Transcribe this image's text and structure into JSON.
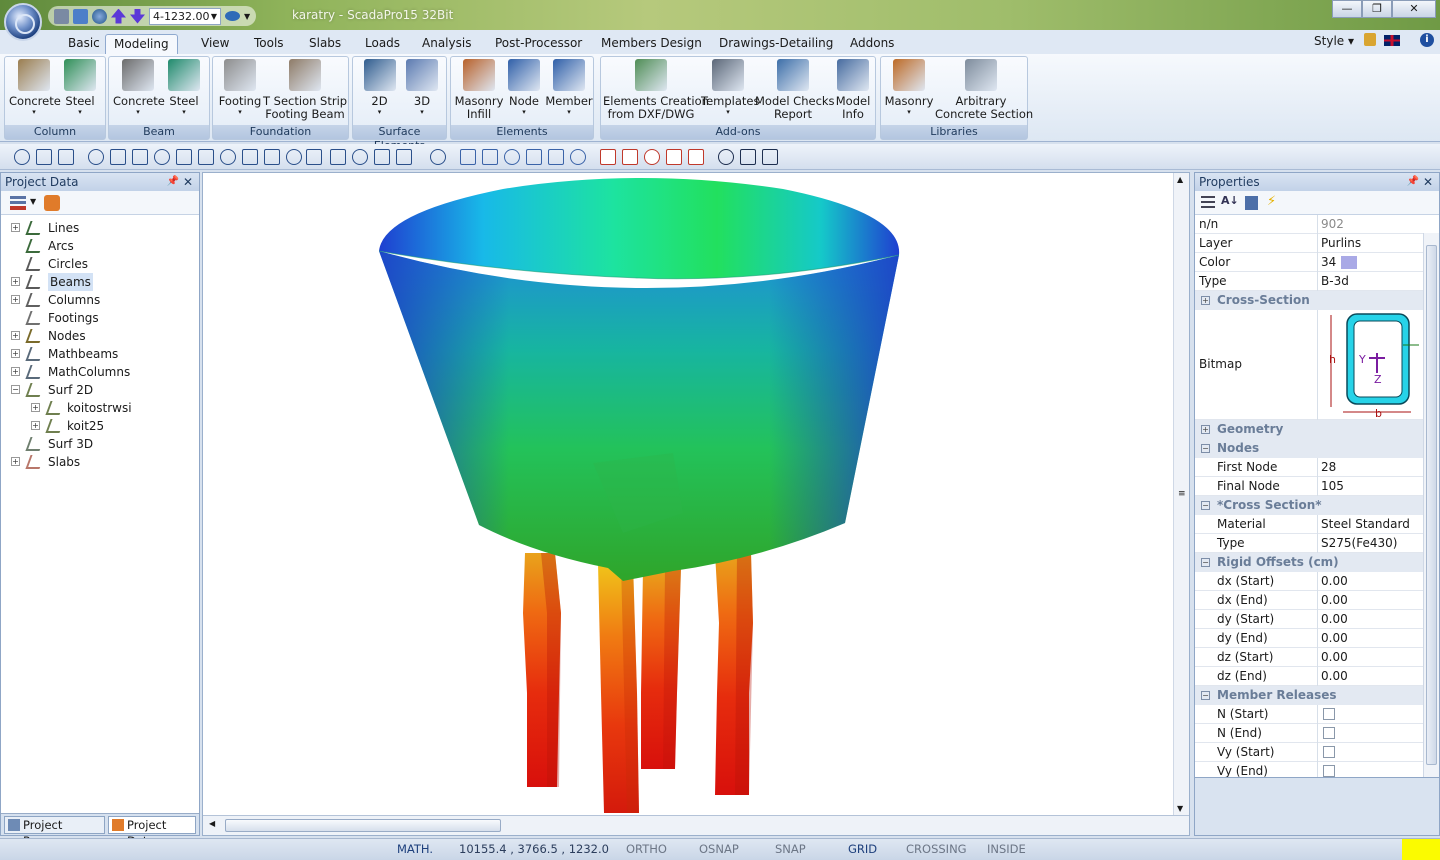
{
  "window": {
    "title": "karatry - ScadaPro15 32Bit",
    "combo_value": "4-1232.00",
    "controls": {
      "minimize": "—",
      "restore": "❐",
      "close": "✕"
    }
  },
  "tabs": [
    "Basic",
    "Modeling",
    "View",
    "Tools",
    "Slabs",
    "Loads",
    "Analysis",
    "Post-Processor",
    "Members Design",
    "Drawings-Detailing",
    "Addons"
  ],
  "active_tab": "Modeling",
  "right_menu": {
    "style_label": "Style"
  },
  "ribbon": {
    "groups": [
      {
        "label": "Column",
        "buttons": [
          {
            "label": "Concrete",
            "icon": "concrete-column-icon"
          },
          {
            "label": "Steel",
            "icon": "steel-column-icon"
          }
        ]
      },
      {
        "label": "Beam",
        "buttons": [
          {
            "label": "Concrete",
            "icon": "concrete-beam-icon"
          },
          {
            "label": "Steel",
            "icon": "steel-beam-icon"
          }
        ]
      },
      {
        "label": "Foundation",
        "buttons": [
          {
            "label": "Footing",
            "icon": "footing-icon"
          },
          {
            "label": "T Section Strip",
            "label2": "Footing Beam",
            "icon": "strip-footing-icon"
          }
        ]
      },
      {
        "label": "Surface Elements",
        "buttons": [
          {
            "label": "2D",
            "icon": "surface-2d-icon"
          },
          {
            "label": "3D",
            "icon": "surface-3d-icon"
          }
        ]
      },
      {
        "label": "Elements",
        "buttons": [
          {
            "label": "Masonry",
            "label2": "Infill",
            "icon": "masonry-infill-icon"
          },
          {
            "label": "Node",
            "icon": "node-icon"
          },
          {
            "label": "Member",
            "icon": "member-icon"
          }
        ]
      },
      {
        "label": "Add-ons",
        "buttons": [
          {
            "label": "Elements Creation",
            "label2": "from DXF/DWG",
            "icon": "dxf-import-icon"
          },
          {
            "label": "Templates",
            "icon": "templates-icon"
          },
          {
            "label": "Model Checks",
            "label2": "Report",
            "icon": "model-checks-icon"
          },
          {
            "label": "Model",
            "label2": "Info",
            "icon": "model-info-icon"
          }
        ]
      },
      {
        "label": "Libraries",
        "buttons": [
          {
            "label": "Masonry",
            "icon": "masonry-library-icon"
          },
          {
            "label": "Arbitrary",
            "label2": "Concrete Section",
            "icon": "arbitrary-section-icon"
          }
        ]
      }
    ]
  },
  "project_panel": {
    "title": "Project Data",
    "tree": [
      {
        "label": "Lines",
        "icon": "line-icon",
        "expandable": true
      },
      {
        "label": "Arcs",
        "icon": "arc-icon",
        "expandable": false
      },
      {
        "label": "Circles",
        "icon": "circle-icon",
        "expandable": false
      },
      {
        "label": "Beams",
        "icon": "beam-icon",
        "expandable": true,
        "selected": true
      },
      {
        "label": "Columns",
        "icon": "column-icon",
        "expandable": true
      },
      {
        "label": "Footings",
        "icon": "footing-icon",
        "expandable": false
      },
      {
        "label": "Nodes",
        "icon": "node-icon",
        "expandable": true
      },
      {
        "label": "Mathbeams",
        "icon": "mathbeam-icon",
        "expandable": true
      },
      {
        "label": "MathColumns",
        "icon": "mathcolumn-icon",
        "expandable": true
      },
      {
        "label": "Surf 2D",
        "icon": "surface-2d-icon",
        "expandable": true,
        "expanded": true
      },
      {
        "label": "koitostrwsi",
        "icon": "surface-2d-icon",
        "expandable": true,
        "child": true
      },
      {
        "label": "koit25",
        "icon": "surface-2d-icon",
        "expandable": true,
        "child": true
      },
      {
        "label": "Surf 3D",
        "icon": "surface-3d-icon",
        "expandable": false
      },
      {
        "label": "Slabs",
        "icon": "slab-icon",
        "expandable": true
      }
    ],
    "bottom_tabs": [
      "Project Param...",
      "Project Data"
    ]
  },
  "properties": {
    "title": "Properties",
    "rows": [
      {
        "kind": "prop",
        "key": "n/n",
        "value": "902",
        "muted": true
      },
      {
        "kind": "prop",
        "key": "Layer",
        "value": "Purlins"
      },
      {
        "kind": "prop",
        "key": "Color",
        "value": "34",
        "swatch": "#a9a9e6"
      },
      {
        "kind": "prop",
        "key": "Type",
        "value": "B-3d"
      },
      {
        "kind": "cat",
        "key": "Cross-Section",
        "collapsed": true
      },
      {
        "kind": "bitmap",
        "key": "Bitmap"
      },
      {
        "kind": "cat",
        "key": "Geometry",
        "collapsed": true
      },
      {
        "kind": "cat",
        "key": "Nodes",
        "collapsed": false
      },
      {
        "kind": "prop",
        "key": "First Node",
        "value": "28",
        "sub": true
      },
      {
        "kind": "prop",
        "key": "Final Node",
        "value": "105",
        "sub": true
      },
      {
        "kind": "cat",
        "key": "*Cross Section*",
        "collapsed": false
      },
      {
        "kind": "prop",
        "key": "Material",
        "value": "Steel Standard",
        "sub": true
      },
      {
        "kind": "prop",
        "key": "Type",
        "value": "S275(Fe430)",
        "sub": true
      },
      {
        "kind": "cat",
        "key": "Rigid Offsets (cm)",
        "collapsed": false
      },
      {
        "kind": "prop",
        "key": "dx (Start)",
        "value": "0.00",
        "sub": true
      },
      {
        "kind": "prop",
        "key": "dx (End)",
        "value": "0.00",
        "sub": true
      },
      {
        "kind": "prop",
        "key": "dy (Start)",
        "value": "0.00",
        "sub": true
      },
      {
        "kind": "prop",
        "key": "dy (End)",
        "value": "0.00",
        "sub": true
      },
      {
        "kind": "prop",
        "key": "dz (Start)",
        "value": "0.00",
        "sub": true
      },
      {
        "kind": "prop",
        "key": "dz (End)",
        "value": "0.00",
        "sub": true
      },
      {
        "kind": "cat",
        "key": "Member Releases",
        "collapsed": false
      },
      {
        "kind": "check",
        "key": "N (Start)",
        "sub": true
      },
      {
        "kind": "check",
        "key": "N (End)",
        "sub": true
      },
      {
        "kind": "check",
        "key": "Vy (Start)",
        "sub": true
      },
      {
        "kind": "check",
        "key": "Vy (End)",
        "sub": true
      }
    ],
    "section_labels": {
      "h": "h",
      "b": "b",
      "y": "Y",
      "z": "Z"
    }
  },
  "status": {
    "math": "MATH.",
    "coords": "10155.4 , 3766.5 , 1232.0",
    "toggles": [
      {
        "label": "ORTHO",
        "on": false
      },
      {
        "label": "OSNAP",
        "on": false
      },
      {
        "label": "SNAP",
        "on": false
      },
      {
        "label": "GRID",
        "on": true
      },
      {
        "label": "CROSSING",
        "on": false
      },
      {
        "label": "INSIDE",
        "on": false
      }
    ]
  },
  "colors": {
    "accent": "#1d3f7c",
    "selection": "#d3e2f5",
    "status_indicator": "#fbfb00"
  }
}
